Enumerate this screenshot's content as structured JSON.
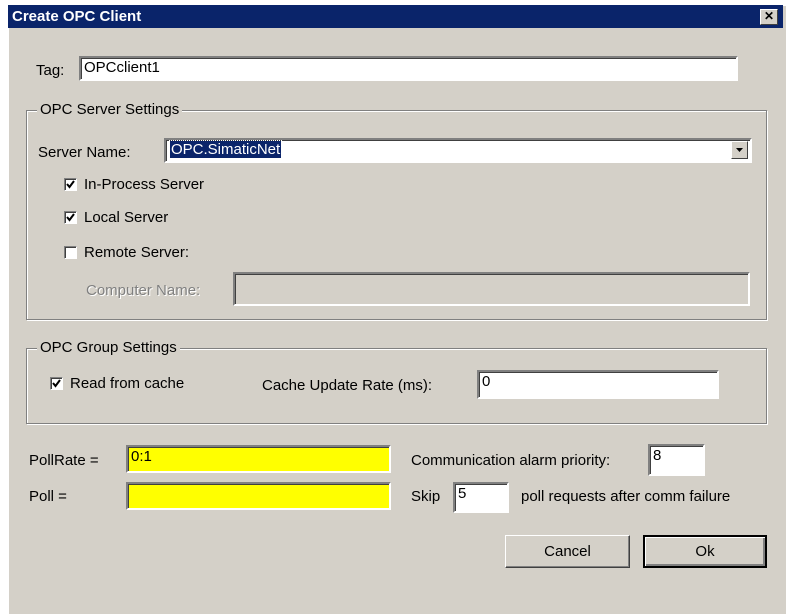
{
  "dialog": {
    "title": "Create OPC Client",
    "close_glyph": "✕"
  },
  "tag": {
    "label": "Tag:",
    "value": "OPCclient1"
  },
  "server_settings": {
    "group_title": "OPC Server Settings",
    "server_name_label": "Server Name:",
    "server_name_value": "OPC.SimaticNet",
    "in_process": {
      "label": "In-Process Server",
      "checked": true
    },
    "local": {
      "label": "Local Server",
      "checked": true
    },
    "remote": {
      "label": "Remote Server:",
      "checked": false
    },
    "computer_name_label": "Computer Name:",
    "computer_name_value": ""
  },
  "group_settings": {
    "group_title": "OPC Group Settings",
    "read_from_cache": {
      "label": "Read from cache",
      "checked": true
    },
    "cache_rate_label": "Cache Update Rate (ms):",
    "cache_rate_value": "0"
  },
  "poll": {
    "pollrate_label": "PollRate =",
    "pollrate_value": "0:1",
    "poll_label": "Poll =",
    "poll_value": "",
    "alarm_priority_label": "Communication alarm priority:",
    "alarm_priority_value": "8",
    "skip_label": "Skip",
    "skip_value": "5",
    "skip_suffix": "poll requests after comm failure"
  },
  "buttons": {
    "cancel": "Cancel",
    "ok": "Ok"
  },
  "colors": {
    "titlebar": "#0a246a",
    "dialog_bg": "#d4d0c8",
    "highlight_field": "#ffff00"
  }
}
